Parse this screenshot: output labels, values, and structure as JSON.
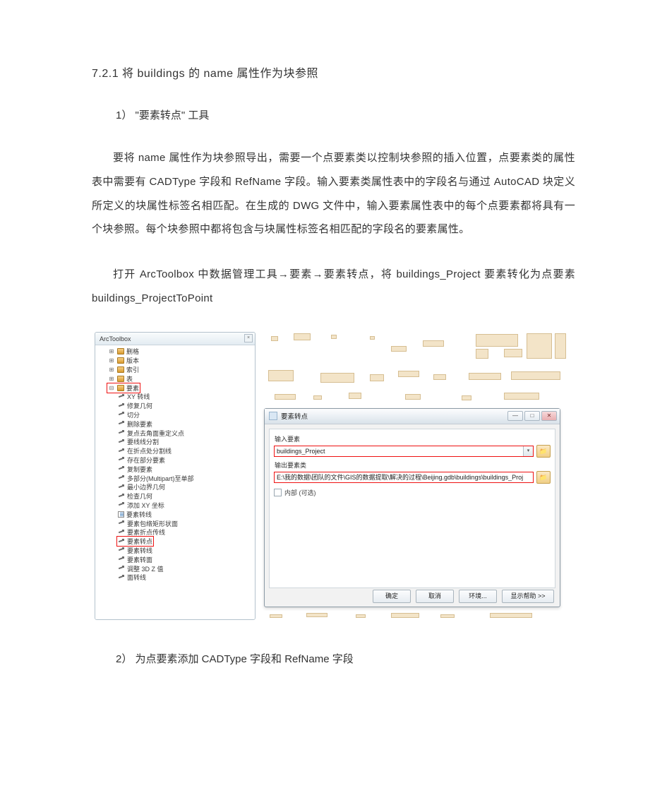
{
  "heading": "7.2.1   将 buildings 的 name 属性作为块参照",
  "step1": "1）   \"要素转点\" 工具",
  "para1": "要将 name 属性作为块参照导出，需要一个点要素类以控制块参照的插入位置，点要素类的属性表中需要有 CADType 字段和 RefName 字段。输入要素类属性表中的字段名与通过 AutoCAD 块定义所定义的块属性标签名相匹配。在生成的 DWG 文件中，输入要素属性表中的每个点要素都将具有一个块参照。每个块参照中都将包含与块属性标签名相匹配的字段名的要素属性。",
  "para2": "打开 ArcToolbox 中数据管理工具→要素→要素转点，将 buildings_Project 要素转化为点要素 buildings_ProjectToPoint",
  "toolbox": {
    "title": "ArcToolbox",
    "folders": [
      "删格",
      "版本",
      "索引",
      "表"
    ],
    "features_group": "要素",
    "tools": [
      "XY 转线",
      "修复几何",
      "切分",
      "删除要素",
      "复点去角面重定义点",
      "要线线分割",
      "在折点处分割线",
      "存在部分要素",
      "复制要素",
      "多部分(Multipart)至单部",
      "最小边界几何",
      "检查几何",
      "添加 XY 坐标",
      "要素转线",
      "要素包络矩形状面",
      "要素折点传线"
    ],
    "highlight_tool": "要素转点",
    "tools_after": [
      "要素转线",
      "要素转面",
      "调整 3D Z 值",
      "面转线"
    ]
  },
  "dialog": {
    "title": "要素转点",
    "label_input": "输入要素",
    "value_input": "buildings_Project",
    "label_output": "输出要素类",
    "value_output": "E:\\我的数据\\团队的文件\\GIS的数据提取\\解决的过程\\Beijing.gdb\\buildings\\buildings_Proj",
    "checkbox": "内部 (可选)",
    "btn_ok": "确定",
    "btn_cancel": "取消",
    "btn_env": "环境...",
    "btn_help": "显示帮助 >>"
  },
  "step2": "2）   为点要素添加 CADType 字段和 RefName 字段"
}
